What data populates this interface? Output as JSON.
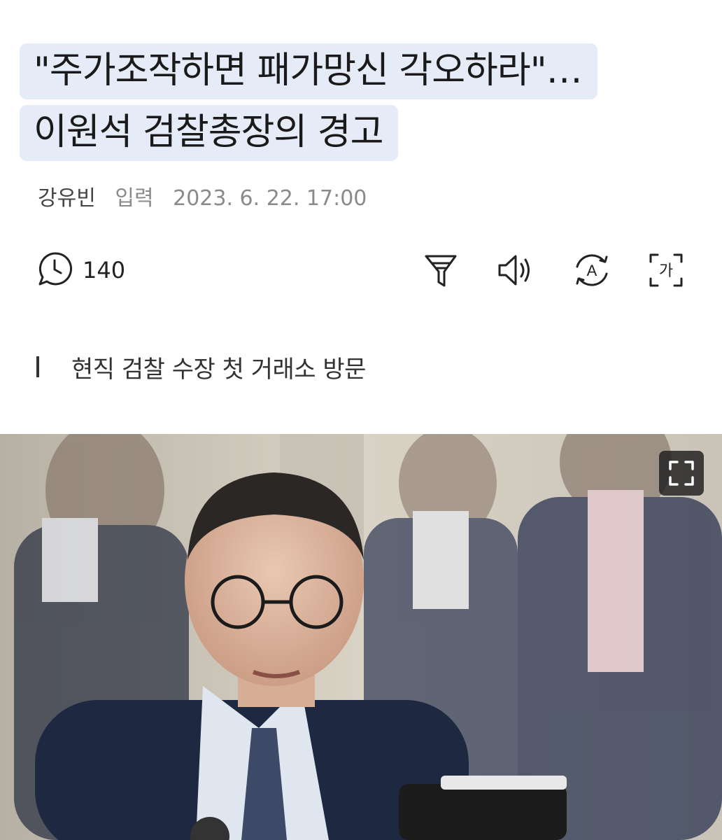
{
  "article": {
    "headline_line1": "\"주가조작하면 패가망신 각오하라\"…",
    "headline_line2": "이원석 검찰총장의 경고",
    "author": "강유빈",
    "input_label": "입력",
    "date": "2023. 6. 22. 17:00",
    "subhead": "현직 검찰 수장 첫 거래소 방문"
  },
  "toolbar": {
    "comment_count": "140",
    "translate_glyph": "A",
    "font_glyph": "가",
    "icons": [
      "comment-icon",
      "summary-icon",
      "audio-icon",
      "translate-icon",
      "font-size-icon"
    ]
  },
  "photo": {
    "expand_icon": "expand-icon"
  },
  "colors": {
    "highlight": "#e6ebf8",
    "text": "#1a1a1a",
    "meta": "#8a8a8a"
  }
}
